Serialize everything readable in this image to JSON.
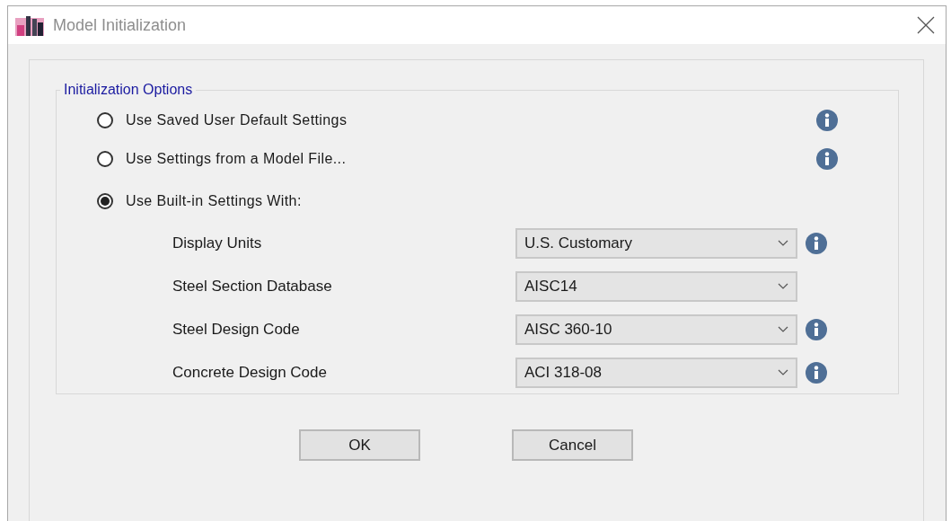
{
  "window": {
    "title": "Model Initialization"
  },
  "group": {
    "title": "Initialization Options"
  },
  "options": [
    {
      "label": "Use Saved User Default Settings",
      "selected": false,
      "info": true
    },
    {
      "label": "Use Settings from a Model File...",
      "selected": false,
      "info": true
    },
    {
      "label": "Use Built-in Settings With:",
      "selected": true,
      "info": false
    }
  ],
  "settings": [
    {
      "label": "Display Units",
      "value": "U.S. Customary",
      "info": true
    },
    {
      "label": "Steel Section Database",
      "value": "AISC14",
      "info": false
    },
    {
      "label": "Steel Design Code",
      "value": "AISC 360-10",
      "info": true
    },
    {
      "label": "Concrete Design Code",
      "value": "ACI 318-08",
      "info": true
    }
  ],
  "buttons": [
    "OK",
    "Cancel"
  ]
}
